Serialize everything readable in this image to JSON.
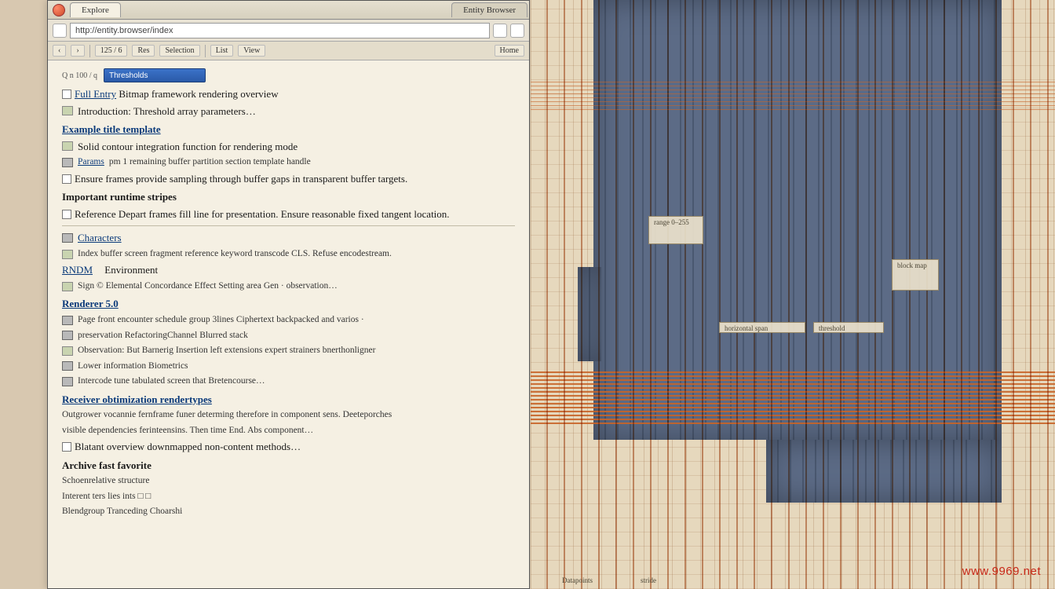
{
  "titlebar": {
    "tab1": "Explore",
    "tab2": "Entity Browser"
  },
  "addressbar": {
    "value": "http://entity.browser/index"
  },
  "toolbar": {
    "nav_back": "‹",
    "nav_fwd": "›",
    "item1": "125 / 6",
    "item2": "Res",
    "item3": "Selection",
    "item4": "List",
    "item5": "View",
    "home": "Home"
  },
  "content": {
    "search_label": "Q n 100 / q",
    "search_value": "Thresholds",
    "line1_label": "Full Entry",
    "line1_text": "Bitmap framework rendering overview",
    "line2_text": "Introduction: Threshold array parameters…",
    "group1": "Example title template",
    "line3_text": "Solid contour integration function for rendering mode",
    "line4_label": "Params",
    "line4_text": "pm 1 remaining buffer partition section template handle",
    "line5_text": "Ensure frames provide sampling through buffer gaps in transparent buffer targets.",
    "group2": "Important runtime stripes",
    "line6_text": "Reference Depart frames fill line for presentation. Ensure reasonable fixed tangent location.",
    "line7_label": "Characters",
    "line7_text": "Index buffer screen fragment reference keyword transcode CLS. Refuse encodestream.",
    "line8_label": "RNDM",
    "line8_title": "Environment",
    "line8_text": "Sign © Elemental Concordance Effect Setting area Gen · observation…",
    "group3": "Renderer 5.0",
    "line9_text": "Page front encounter schedule group 3lines Ciphertext backpacked and varios ·",
    "line10_text": "preservation RefactoringChannel Blurred stack",
    "line11_text": "Observation: But Barnerig Insertion left extensions expert strainers bnerthonligner",
    "line12_text": "Lower information Biometrics",
    "line13_text": "Intercode tune tabulated screen that Bretencourse…",
    "group4": "Receiver obtimization rendertypes",
    "line14_text": "Outgrower vocannie fernframe funer determing therefore in component sens. Deeteporches",
    "line15_text": "visible dependencies ferinteensins. Then time End. Abs component…",
    "line16_text": "Blatant overview downmapped non-content methods…",
    "group5": "Archive fast favorite",
    "line17_text": "Schoenrelative structure",
    "line18_text": "Interent ters lies ints □ □",
    "line19_text": "Blendgroup Tranceding Choarshi"
  },
  "visualization": {
    "legend1": "range 0–255",
    "legend2": "horizontal span",
    "legend3": "threshold",
    "legend4": "block map",
    "axis1": "Datapoints",
    "axis2": "stride"
  },
  "watermark": "www.9969.net"
}
